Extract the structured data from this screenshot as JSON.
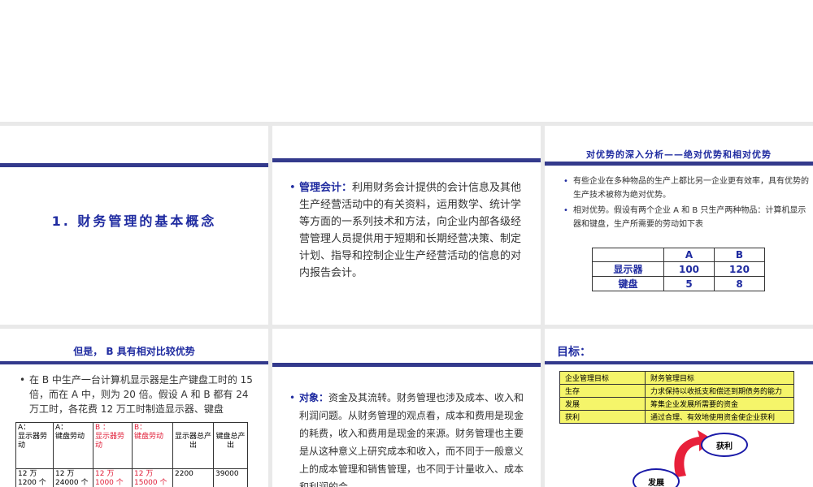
{
  "slide1": {
    "title": "1. 财务管理的基本概念"
  },
  "slide2": {
    "label": "管理会计：",
    "text": "利用财务会计提供的会计信息及其他生产经营活动中的有关资料，运用数学、统计学等方面的一系列技术和方法，向企业内部各级经营管理人员提供用于短期和长期经营决策、制定计划、指导和控制企业生产经营活动的信息的对内报告会计。"
  },
  "slide3": {
    "title": "对优势的深入分析——绝对优势和相对优势",
    "bullets": [
      "有些企业在多种物品的生产上都比另一企业更有效率，具有优势的生产技术被称为绝对优势。",
      "相对优势。假设有两个企业 A 和 B 只生产两种物品：计算机显示器和键盘，生产所需要的劳动如下表"
    ],
    "table": {
      "headers": [
        "",
        "A",
        "B"
      ],
      "rows": [
        [
          "显示器",
          "100",
          "120"
        ],
        [
          "键盘",
          "5",
          "8"
        ]
      ]
    }
  },
  "slide4": {
    "title": "但是， B 具有相对比较优势",
    "bullet": "在 B 中生产一台计算机显示器是生产键盘工时的 15 倍，而在 A 中，则为 20 倍。假设 A 和 B 都有 24 万工时，各花费 12 万工时制造显示器、键盘",
    "table": {
      "headers": [
        [
          "A：",
          "显示器劳动"
        ],
        [
          "A：",
          "键盘劳动"
        ],
        [
          "B ：",
          "显示器劳动"
        ],
        [
          "B：",
          "键盘劳动"
        ],
        [
          "",
          "显示器总产出"
        ],
        [
          "",
          "键盘总产出"
        ]
      ],
      "row": [
        [
          "12 万",
          "1200 个"
        ],
        [
          "12 万",
          "24000 个"
        ],
        [
          "12 万",
          "1000 个"
        ],
        [
          "12 万",
          "15000 个"
        ],
        [
          "2200",
          ""
        ],
        [
          "39000",
          ""
        ]
      ]
    }
  },
  "slide5": {
    "label": "对象：",
    "text": "资金及其流转。财务管理也涉及成本、收入和利润问题。从财务管理的观点看，成本和费用是现金的耗费，收入和费用是现金的来源。财务管理也主要是从这种意义上研究成本和收入，而不同于一般意义上的成本管理和销售管理，也不同于计量收入、成本和利润的会"
  },
  "slide6": {
    "title": "目标：",
    "table": [
      [
        "企业管理目标",
        "财务管理目标"
      ],
      [
        "生存",
        "力求保持以收抵支和偿还到期债务的能力"
      ],
      [
        "发展",
        "筹集企业发展所需要的资金"
      ],
      [
        "获利",
        "通过合理、有效地使用资金使企业获利"
      ]
    ],
    "diagram": {
      "node1": "获利",
      "node2": "发展"
    }
  },
  "colors": {
    "accent": "#333a8c",
    "title": "#1f2ba0",
    "highlight": "#f5f56a",
    "arrow": "#e8203a"
  }
}
